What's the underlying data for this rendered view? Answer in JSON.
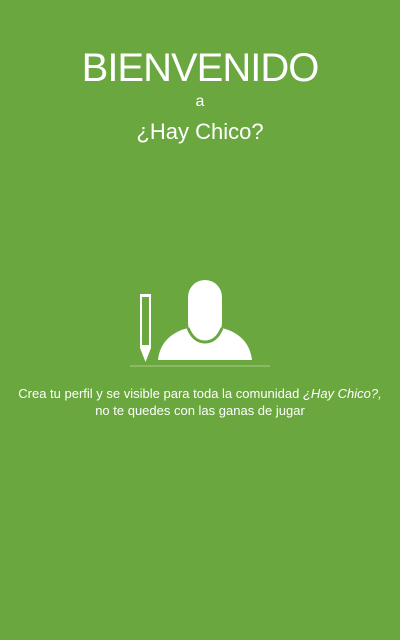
{
  "welcome": {
    "title": "BIENVENIDO",
    "connector": "a",
    "app_name": "¿Hay Chico?"
  },
  "hero": {
    "icon": "profile-pencil-icon"
  },
  "description": {
    "line1_text": "Crea tu perfil y se visible para toda la comunidad ",
    "line1_highlight": "¿Hay Chico?,",
    "line2_text": "no te quedes con las ganas de jugar"
  },
  "colors": {
    "background": "#6aa73f",
    "foreground": "#ffffff"
  }
}
